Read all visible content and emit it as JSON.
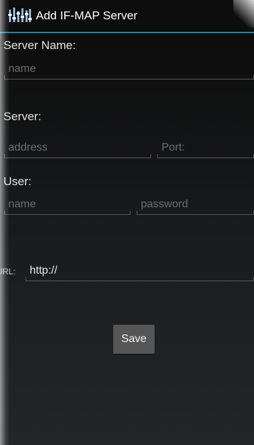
{
  "title_bar": {
    "title": "Add IF-MAP Server",
    "icon": "equalizer-icon"
  },
  "form": {
    "server_name": {
      "label": "Server Name:",
      "name_placeholder": "name",
      "name_value": ""
    },
    "server": {
      "label": "Server:",
      "address_placeholder": "address",
      "address_value": "",
      "port_placeholder": "Port:",
      "port_value": ""
    },
    "user": {
      "label": "User:",
      "name_placeholder": "name",
      "name_value": "",
      "password_placeholder": "password",
      "password_value": ""
    },
    "url": {
      "label": "URL:",
      "value": "http://"
    },
    "save_label": "Save"
  },
  "colors": {
    "accent_line": "#2a7fa8",
    "background": "#141516",
    "button": "#565656"
  }
}
